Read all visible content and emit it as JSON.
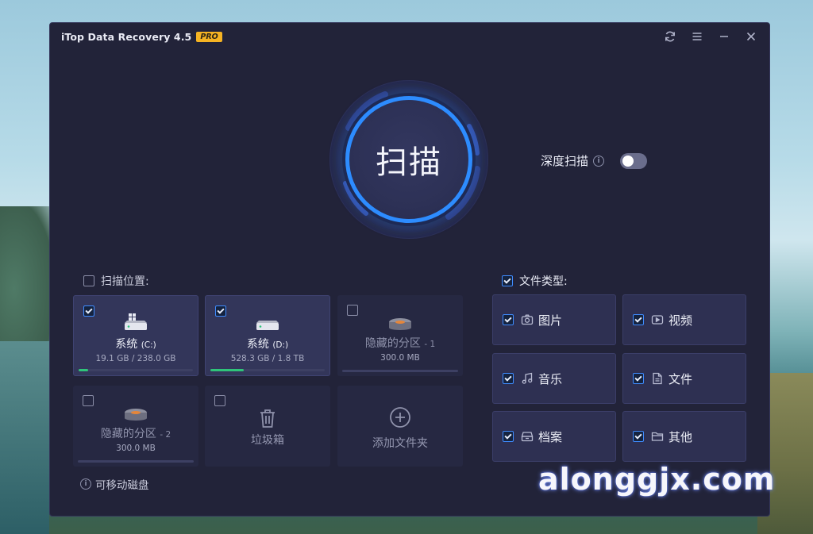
{
  "window": {
    "title": "iTop Data Recovery 4.5",
    "badge": "PRO",
    "controls": [
      "refresh-icon",
      "menu-icon",
      "minimize-icon",
      "close-icon"
    ]
  },
  "scan": {
    "button_label": "扫描",
    "deep_scan_label": "深度扫描",
    "deep_scan_enabled": false
  },
  "locations": {
    "header": "扫描位置:",
    "checked": false,
    "drives": [
      {
        "name": "系统",
        "letter": "(C:)",
        "size": "19.1 GB / 238.0 GB",
        "checked": true,
        "used_fraction": 0.08,
        "icon": "windows-drive-icon"
      },
      {
        "name": "系统",
        "letter": "(D:)",
        "size": "528.3 GB / 1.8 TB",
        "checked": true,
        "used_fraction": 0.29,
        "icon": "drive-icon"
      },
      {
        "name": "隐藏的分区",
        "suffix": "- 1",
        "size": "300.0 MB",
        "checked": false,
        "icon": "hidden-drive-icon"
      },
      {
        "name": "隐藏的分区",
        "suffix": "- 2",
        "size": "300.0 MB",
        "checked": false,
        "icon": "hidden-drive-icon"
      }
    ],
    "trash": {
      "label": "垃圾箱",
      "checked": false,
      "icon": "trash-icon"
    },
    "add_folder": {
      "label": "添加文件夹",
      "icon": "plus-circle-icon"
    },
    "removable": "可移动磁盘"
  },
  "file_types": {
    "header": "文件类型:",
    "checked": true,
    "items": [
      {
        "label": "图片",
        "icon": "camera-icon",
        "checked": true
      },
      {
        "label": "视频",
        "icon": "video-icon",
        "checked": true
      },
      {
        "label": "音乐",
        "icon": "music-icon",
        "checked": true
      },
      {
        "label": "文件",
        "icon": "document-icon",
        "checked": true
      },
      {
        "label": "档案",
        "icon": "archive-icon",
        "checked": true
      },
      {
        "label": "其他",
        "icon": "folder-icon",
        "checked": true
      }
    ]
  },
  "watermark": "alonggjx.com",
  "colors": {
    "accent": "#2d8cff",
    "usage_bar": "#2fc47a",
    "badge": "#f5b323",
    "window_bg": "#222339"
  }
}
